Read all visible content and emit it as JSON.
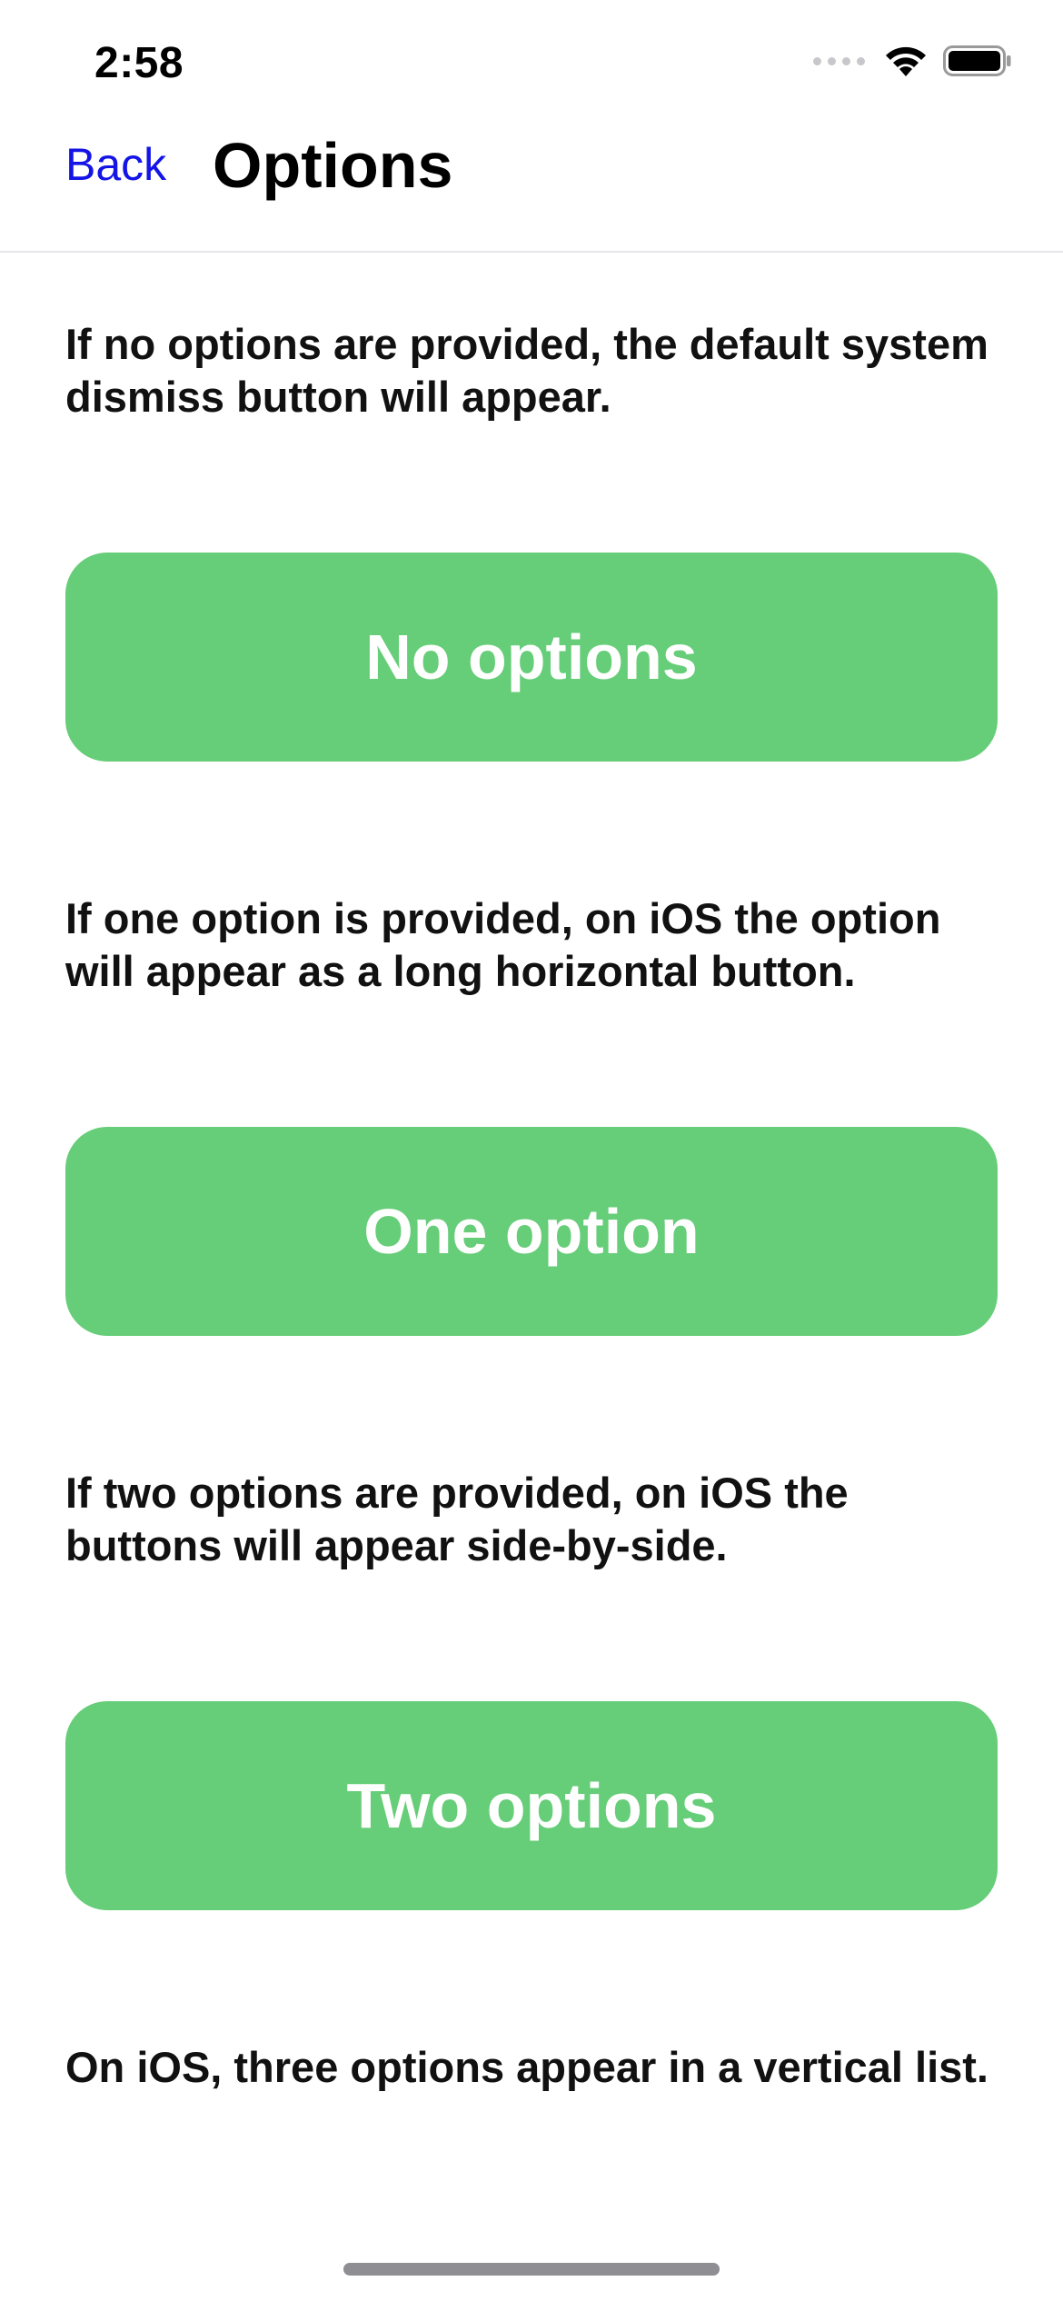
{
  "status_bar": {
    "time": "2:58",
    "icons": [
      "cellular-signal-icon",
      "wifi-icon",
      "battery-icon"
    ]
  },
  "nav": {
    "back_label": "Back",
    "title": "Options"
  },
  "sections": [
    {
      "description": "If no options are provided, the default system dismiss button will appear.",
      "button_label": "No options"
    },
    {
      "description": "If one option is provided, on iOS the option will appear as a long horizontal button.",
      "button_label": "One option"
    },
    {
      "description": "If two options are provided, on iOS the buttons will appear side-by-side.",
      "button_label": "Two options"
    },
    {
      "description": "On iOS, three options appear in a vertical list."
    }
  ],
  "colors": {
    "accent_link": "#1414e6",
    "button_green": "#66cd78",
    "button_text": "#ffffff"
  }
}
